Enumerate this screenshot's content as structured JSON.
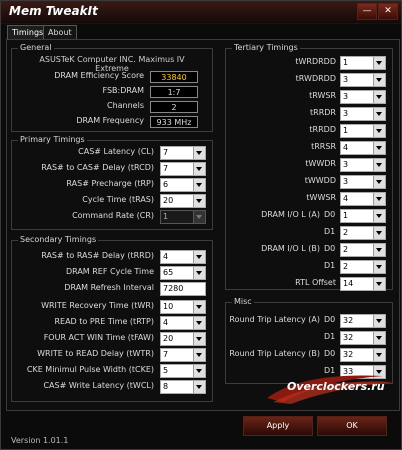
{
  "app_title": "Mem TweakIt",
  "window_buttons": {
    "minimize": "—",
    "close": "✕"
  },
  "tabs": [
    "Timings",
    "About"
  ],
  "general": {
    "title": "General",
    "board": "ASUSTeK Computer INC. Maximus IV Extreme",
    "rows": [
      {
        "label": "DRAM Efficiency Score",
        "value": "33840"
      },
      {
        "label": "FSB:DRAM",
        "value": "1:7"
      },
      {
        "label": "Channels",
        "value": "2"
      },
      {
        "label": "DRAM Frequency",
        "value": "933 MHz"
      }
    ]
  },
  "primary": {
    "title": "Primary Timings",
    "rows": [
      {
        "label": "CAS# Latency (CL)",
        "value": "7"
      },
      {
        "label": "RAS# to CAS# Delay (tRCD)",
        "value": "7"
      },
      {
        "label": "RAS# Precharge (tRP)",
        "value": "6"
      },
      {
        "label": "Cycle Time (tRAS)",
        "value": "20"
      },
      {
        "label": "Command Rate (CR)",
        "value": "1"
      }
    ]
  },
  "secondary": {
    "title": "Secondary Timings",
    "rows": [
      {
        "label": "RAS# to RAS# Delay (tRRD)",
        "value": "4"
      },
      {
        "label": "DRAM REF Cycle Time",
        "value": "65"
      },
      {
        "label": "DRAM Refresh Interval",
        "value": "7280"
      },
      {
        "label": "WRITE Recovery Time (tWR)",
        "value": "10"
      },
      {
        "label": "READ to PRE Time (tRTP)",
        "value": "4"
      },
      {
        "label": "FOUR ACT WIN Time (tFAW)",
        "value": "20"
      },
      {
        "label": "WRITE to READ Delay (tWTR)",
        "value": "7"
      },
      {
        "label": "CKE Minimul Pulse Width (tCKE)",
        "value": "5"
      },
      {
        "label": "CAS# Write Latency (tWCL)",
        "value": "8"
      }
    ]
  },
  "tertiary": {
    "title": "Tertiary Timings",
    "rows": [
      {
        "label": "tWRDRDD",
        "value": "1"
      },
      {
        "label": "tRWDRDD",
        "value": "3"
      },
      {
        "label": "tRWSR",
        "value": "3"
      },
      {
        "label": "tRRDR",
        "value": "3"
      },
      {
        "label": "tRRDD",
        "value": "1"
      },
      {
        "label": "tRRSR",
        "value": "4"
      },
      {
        "label": "tWWDR",
        "value": "3"
      },
      {
        "label": "tWWDD",
        "value": "3"
      },
      {
        "label": "tWWSR",
        "value": "4"
      }
    ],
    "io_a": {
      "label": "DRAM I/O L (A)",
      "d0": "D0",
      "d1": "D1",
      "v0": "1",
      "v1": "2"
    },
    "io_b": {
      "label": "DRAM I/O L (B)",
      "d0": "D0",
      "d1": "D1",
      "v0": "2",
      "v1": "2"
    },
    "rtl": {
      "label": "RTL Offset",
      "value": "14"
    }
  },
  "misc": {
    "title": "Misc",
    "rtl_a": {
      "label": "Round Trip Latency (A)",
      "d0": "D0",
      "d1": "D1",
      "v0": "32",
      "v1": "32"
    },
    "rtl_b": {
      "label": "Round Trip Latency (B)",
      "d0": "D0",
      "d1": "D1",
      "v0": "32",
      "v1": "33"
    }
  },
  "logo_text": "Overclockers.ru",
  "buttons": {
    "apply": "Apply",
    "ok": "OK"
  },
  "version": "Version 1.01.1"
}
